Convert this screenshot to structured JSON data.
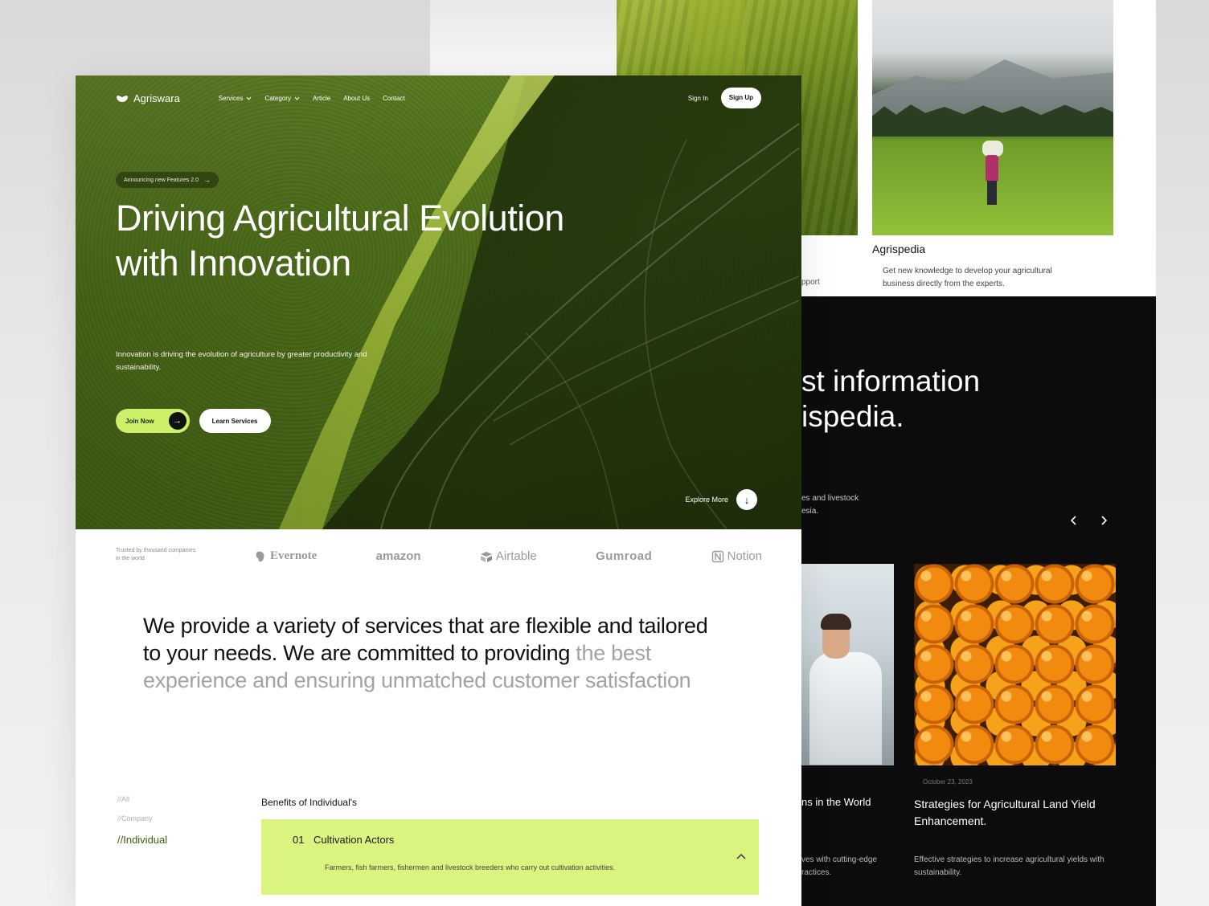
{
  "nav": {
    "brand": "Agriswara",
    "links": [
      {
        "label": "Services",
        "dropdown": true
      },
      {
        "label": "Category",
        "dropdown": true
      },
      {
        "label": "Article",
        "dropdown": false
      },
      {
        "label": "About Us",
        "dropdown": false
      },
      {
        "label": "Contact",
        "dropdown": false
      }
    ],
    "signin": "Sign In",
    "signup": "Sign Up"
  },
  "hero": {
    "announcement": "Announcing new Features 2.0",
    "title_line1": "Driving Agricultural Evolution",
    "title_line2": "with Innovation",
    "description": "Innovation is driving the evolution of agriculture by greater productivity and sustainability.",
    "join_label": "Join Now",
    "learn_label": "Learn Services",
    "explore_label": "Explore More"
  },
  "trusted": {
    "text": "Trusted by thousand companies in the world",
    "brands": [
      "Evernote",
      "amazon",
      "Airtable",
      "Gumroad",
      "Notion"
    ]
  },
  "services": {
    "text_main": "We provide a variety of services that are flexible and tailored to your needs. We are committed to providing ",
    "text_muted": "the best experience and ensuring unmatched customer satisfaction"
  },
  "filters": [
    "//All",
    "//Company",
    "//Individual"
  ],
  "benefits": {
    "title": "Benefits of Individual's",
    "item_number": "01",
    "item_title": "Cultivation Actors",
    "item_desc": "Farmers, fish farmers, fishermen and livestock breeders who carry out cultivation activities."
  },
  "back": {
    "support_fragment": "pport",
    "agrispedia_title": "Agrispedia",
    "agrispedia_desc": "Get new knowledge to develop your agricultural business directly from the experts.",
    "dark_heading": "st information\nispedia.",
    "dark_sub": "es and livestock\nesia.",
    "card_left_title": "ns in the World",
    "card_left_desc": "ves with cutting-edge\nractices.",
    "card_right_date": "October 23, 2023",
    "card_right_title": "Strategies for Agricultural Land Yield Enhancement.",
    "card_right_desc": "Effective strategies to increase agricultural yields with sustainability."
  },
  "colors": {
    "accent_lime": "#d9f580",
    "button_lime": "#cdf06a",
    "dark": "#0c0c0c"
  }
}
